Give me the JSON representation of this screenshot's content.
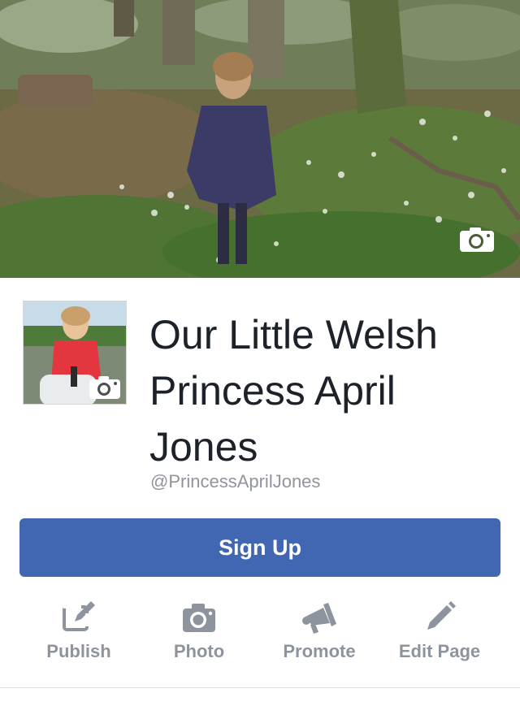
{
  "page": {
    "name": "Our Little Welsh Princess April Jones",
    "handle": "@PrincessAprilJones"
  },
  "cover": {
    "camera_icon": "camera-icon"
  },
  "profile": {
    "camera_icon": "camera-icon"
  },
  "signup": {
    "label": "Sign Up"
  },
  "actions": [
    {
      "label": "Publish",
      "icon": "compose-icon"
    },
    {
      "label": "Photo",
      "icon": "camera-icon"
    },
    {
      "label": "Promote",
      "icon": "megaphone-icon"
    },
    {
      "label": "Edit Page",
      "icon": "pencil-icon"
    }
  ],
  "colors": {
    "accent": "#4267b2",
    "action_gray": "#8d949e",
    "handle_gray": "#90949c",
    "name_text": "#1d2129"
  }
}
